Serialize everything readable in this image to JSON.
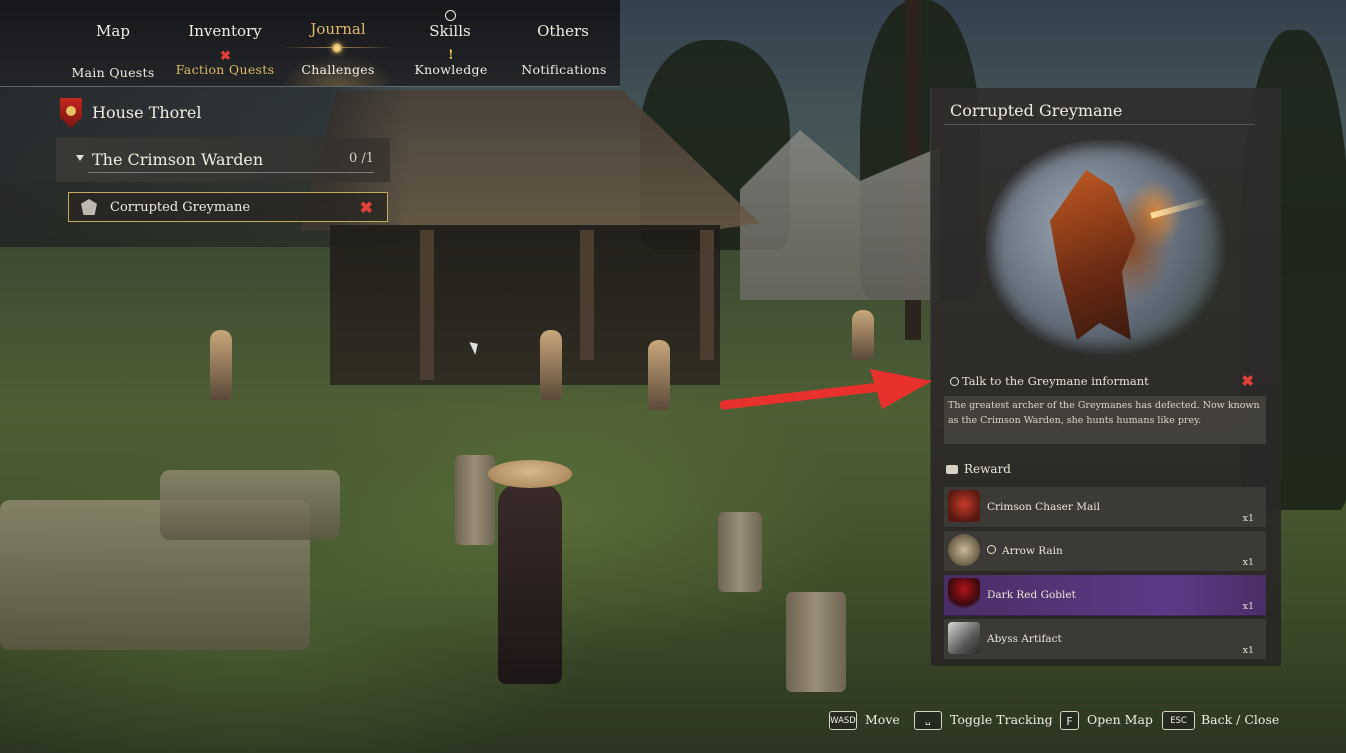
{
  "nav": {
    "tabs": [
      {
        "label": "Map",
        "active": false
      },
      {
        "label": "Inventory",
        "active": false
      },
      {
        "label": "Journal",
        "active": true
      },
      {
        "label": "Skills",
        "active": false
      },
      {
        "label": "Others",
        "active": false
      }
    ],
    "subtabs": [
      {
        "label": "Main  Quests",
        "active": false
      },
      {
        "label": "Faction  Quests",
        "active": true
      },
      {
        "label": "Challenges",
        "active": false
      },
      {
        "label": "Knowledge",
        "active": false
      },
      {
        "label": "Notifications",
        "active": false
      }
    ]
  },
  "quest_list": {
    "faction": "House  Thorel",
    "group": {
      "title": "The  Crimson  Warden",
      "count": "0 /1"
    },
    "items": [
      {
        "label": "Corrupted  Greymane",
        "tracked": true
      }
    ]
  },
  "detail": {
    "title": "Corrupted  Greymane",
    "objective": "Talk  to  the  Greymane  informant",
    "description": "The greatest archer of the Greymanes has defected. Now known as the Crimson Warden, she hunts humans like prey.",
    "reward_heading": "Reward",
    "rewards": [
      {
        "label": "Crimson  Chaser  Mail",
        "count": "x1",
        "icon": "armor-icon",
        "highlight": false
      },
      {
        "label": "Arrow  Rain",
        "count": "x1",
        "icon": "skill-scroll-icon",
        "highlight": false,
        "skill": true
      },
      {
        "label": "Dark  Red  Goblet",
        "count": "x1",
        "icon": "goblet-icon",
        "highlight": true
      },
      {
        "label": "Abyss  Artifact",
        "count": "x1",
        "icon": "artifact-icon",
        "highlight": false
      }
    ]
  },
  "hints": [
    {
      "key": "WASD",
      "label": "Move"
    },
    {
      "key": "␣",
      "label": "Toggle  Tracking"
    },
    {
      "key": "F",
      "label": "Open  Map"
    },
    {
      "key": "ESC",
      "label": "Back  /  Close"
    }
  ],
  "colors": {
    "accent_gold": "#e0b866",
    "tracking_red": "#e0413a",
    "rare_purple": "#5d3a86",
    "arrow_red": "#e8312c"
  }
}
